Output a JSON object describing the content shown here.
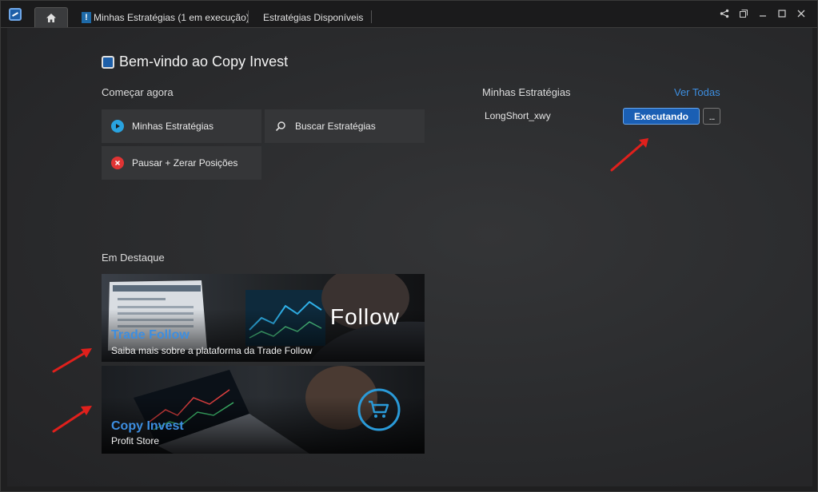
{
  "tabs": {
    "home_icon": "home-icon",
    "strategies_running": "Minhas Estratégias (1 em execução)",
    "strategies_badge": "!",
    "available": "Estratégias Disponíveis"
  },
  "window_controls": [
    "share-icon",
    "restore-window-icon",
    "minimize-icon",
    "maximize-icon",
    "close-icon"
  ],
  "welcome": {
    "title": "Bem-vindo ao Copy Invest"
  },
  "start": {
    "title": "Começar agora",
    "tiles": [
      {
        "label": "Minhas Estratégias",
        "icon": "play-icon"
      },
      {
        "label": "Buscar Estratégias",
        "icon": "search-icon"
      },
      {
        "label": "Pausar + Zerar Posições",
        "icon": "close-circle-icon"
      }
    ]
  },
  "my_strategies": {
    "title": "Minhas Estratégias",
    "see_all": "Ver Todas",
    "items": [
      {
        "name": "LongShort_xwy",
        "status": "Executando",
        "more": "..."
      }
    ]
  },
  "featured": {
    "title": "Em Destaque",
    "banners": [
      {
        "title": "Trade Follow",
        "subtitle": "Saiba mais sobre a plataforma da Trade Follow",
        "logo_text": "Follow"
      },
      {
        "title": "Copy Invest",
        "subtitle": "Profit Store",
        "icon": "cart-icon"
      }
    ]
  },
  "colors": {
    "accent": "#3d8ee0",
    "button_blue": "#1a5fb4",
    "background": "#2a2b2d",
    "annotation_arrow": "#e0201c"
  }
}
